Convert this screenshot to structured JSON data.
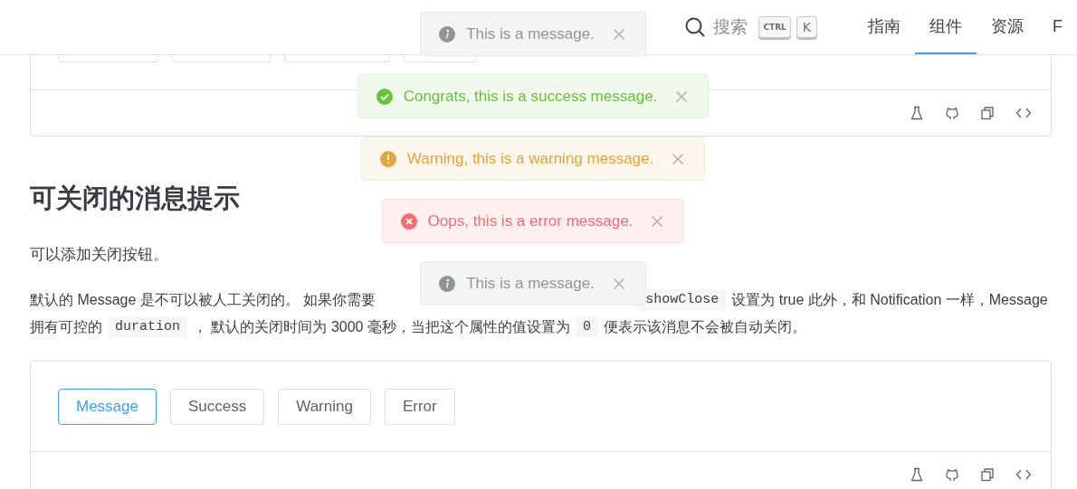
{
  "header": {
    "search": {
      "label": "搜索"
    },
    "keys": [
      "CTRL",
      "K"
    ],
    "nav": [
      {
        "label": "指南",
        "selected": false
      },
      {
        "label": "组件",
        "selected": true
      },
      {
        "label": "资源",
        "selected": false
      },
      {
        "label": "F",
        "selected": false
      }
    ]
  },
  "section": {
    "title": "可关闭的消息提示",
    "intro": "可以添加关闭按钮。",
    "lines": [
      [
        {
          "kind": "text",
          "text": "默认的 Message 是不可以被人工关闭的。 如果你需要"
        },
        {
          "kind": "code",
          "text": "showClose"
        },
        {
          "kind": "text",
          "text": "设置为 true 此外，和 Notification 一样，Message"
        }
      ],
      [
        {
          "kind": "text",
          "text": "拥有可控的"
        },
        {
          "kind": "code",
          "text": "duration"
        },
        {
          "kind": "text",
          "text": "， 默认的关闭时间为 3000 毫秒，当把这个属性的值设置为"
        },
        {
          "kind": "code",
          "text": "0"
        },
        {
          "kind": "text",
          "text": "便表示该消息不会被自动关闭。"
        }
      ]
    ],
    "buttons": [
      {
        "label": "Message",
        "selected": true
      },
      {
        "label": "Success",
        "selected": false
      },
      {
        "label": "Warning",
        "selected": false
      },
      {
        "label": "Error",
        "selected": false
      }
    ]
  },
  "messages": [
    {
      "kind": "info",
      "text": "This is a message."
    },
    {
      "kind": "success",
      "text": "Congrats, this is a success message."
    },
    {
      "kind": "warning",
      "text": "Warning, this is a warning message."
    },
    {
      "kind": "error",
      "text": "Oops, this is a error message."
    },
    {
      "kind": "info",
      "text": "This is a message."
    }
  ]
}
